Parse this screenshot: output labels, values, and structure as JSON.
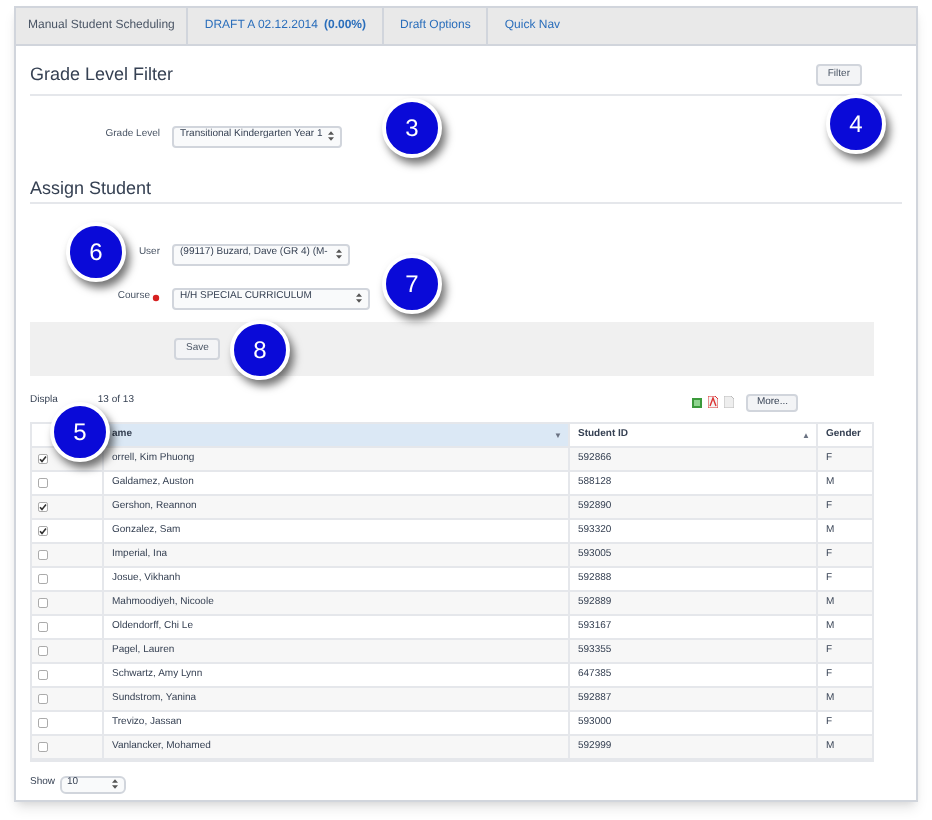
{
  "nav": {
    "title": "Manual Student Scheduling",
    "draft": "DRAFT A 02.12.2014",
    "percent": "(0.00%)",
    "menus": [
      "Draft Options",
      "Quick Nav"
    ]
  },
  "grade_filter": {
    "title": "Grade Level Filter",
    "button": "Filter",
    "label": "Grade Level",
    "value": "Transitional Kindergarten Year 1"
  },
  "assign": {
    "title": "Assign Student",
    "user_label": "User",
    "user_value": "(99117) Buzard, Dave (GR 4) (M-",
    "course_label": "Course",
    "course_required": true,
    "course_value": "H/H SPECIAL CURRICULUM",
    "save": "Save"
  },
  "list": {
    "status_parts": [
      "Displa",
      "13 of 13"
    ],
    "more": "More...",
    "columns": [
      {
        "label": "ame",
        "sort_mark": "▼",
        "highlighted": true
      },
      {
        "label": "Student ID",
        "sort_mark": "▲",
        "highlighted": false
      },
      {
        "label": "Gender",
        "highlighted": false
      }
    ],
    "rows": [
      {
        "checked": true,
        "cells": [
          "orrell, Kim Phuong",
          "592866",
          "F"
        ]
      },
      {
        "checked": false,
        "cells": [
          "Galdamez, Auston",
          "588128",
          "M"
        ]
      },
      {
        "checked": true,
        "cells": [
          "Gershon, Reannon",
          "592890",
          "F"
        ]
      },
      {
        "checked": true,
        "cells": [
          "Gonzalez, Sam",
          "593320",
          "M"
        ]
      },
      {
        "checked": false,
        "cells": [
          "Imperial, Ina",
          "593005",
          "F"
        ]
      },
      {
        "checked": false,
        "cells": [
          "Josue, Vikhanh",
          "592888",
          "F"
        ]
      },
      {
        "checked": false,
        "cells": [
          "Mahmoodiyeh, Nicoole",
          "592889",
          "M"
        ]
      },
      {
        "checked": false,
        "cells": [
          "Oldendorff, Chi Le",
          "593167",
          "M"
        ]
      },
      {
        "checked": false,
        "cells": [
          "Pagel, Lauren",
          "593355",
          "F"
        ]
      },
      {
        "checked": false,
        "cells": [
          "Schwartz, Amy Lynn",
          "647385",
          "F"
        ]
      },
      {
        "checked": false,
        "cells": [
          "Sundstrom, Yanina",
          "592887",
          "M"
        ]
      },
      {
        "checked": false,
        "cells": [
          "Trevizo, Jassan",
          "593000",
          "F"
        ]
      },
      {
        "checked": false,
        "cells": [
          "Vanlancker, Mohamed",
          "592999",
          "M"
        ]
      }
    ],
    "show_label": "Show",
    "page_size": "10"
  },
  "callouts": [
    "3",
    "4",
    "5",
    "6",
    "7",
    "8"
  ]
}
